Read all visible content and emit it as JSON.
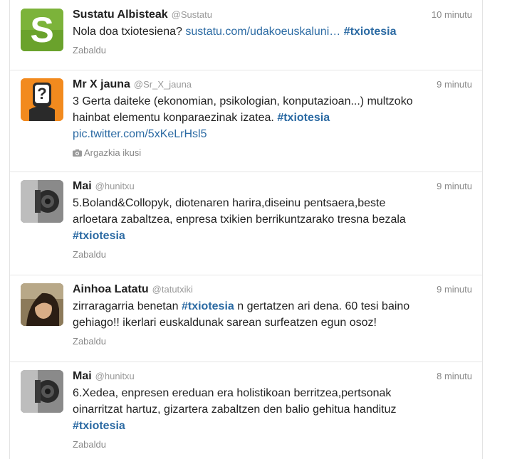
{
  "tweets": [
    {
      "name": "Sustatu Albisteak",
      "handle": "@Sustatu",
      "time": "10 minutu",
      "avatar_icon": "sustatu-s-logo",
      "avatar_letter": "S",
      "text": {
        "t1": "Nola doa txiotesiena?",
        "link": "sustatu.com/udakoeuskaluni…",
        "hashtag": "#txiotesia"
      },
      "action": "Zabaldu"
    },
    {
      "name": "Mr X jauna",
      "handle": "@Sr_X_jauna",
      "time": "9 minutu",
      "avatar_icon": "question-mark-avatar",
      "avatar_letter": "?",
      "text": {
        "line1": "3 Gerta daiteke (ekonomian, psikologian, konputazioan...) multzoko",
        "line2a": "hainbat elementu konparaezinak izatea.",
        "hashtag": "#txiotesia",
        "link": "pic.twitter.com/5xKeLrHsl5"
      },
      "action": "Argazkia ikusi"
    },
    {
      "name": "Mai",
      "handle": "@hunitxu",
      "time": "9 minutu",
      "avatar_icon": "camera-photo-avatar",
      "text": {
        "line1": "5.Boland&Collopyk, diotenaren harira,diseinu pentsaera,beste",
        "line2": "arloetara zabaltzea, enpresa txikien berrikuntzarako tresna bezala",
        "hashtag": "#txiotesia"
      },
      "action": "Zabaldu"
    },
    {
      "name": "Ainhoa Latatu",
      "handle": "@tatutxiki",
      "time": "9 minutu",
      "avatar_icon": "portrait-photo-avatar",
      "text": {
        "t1": "zirraragarria benetan",
        "hashtag": "#txiotesia",
        "t2": "n gertatzen ari dena. 60 tesi baino",
        "line2": "gehiago!! ikerlari euskaldunak sarean surfeatzen egun osoz!"
      },
      "action": "Zabaldu"
    },
    {
      "name": "Mai",
      "handle": "@hunitxu",
      "time": "8 minutu",
      "avatar_icon": "camera-photo-avatar",
      "text": {
        "line1": "6.Xedea, enpresen ereduan era holistikoan berritzea,pertsonak",
        "line2": "oinarritzat hartuz, gizartera zabaltzen den balio gehitua handituz",
        "hashtag": "#txiotesia"
      },
      "action": "Zabaldu"
    }
  ],
  "colors": {
    "link": "#2b6aa3",
    "sustatu_green": "#7cb33a",
    "mrx_orange": "#f28a1e"
  }
}
